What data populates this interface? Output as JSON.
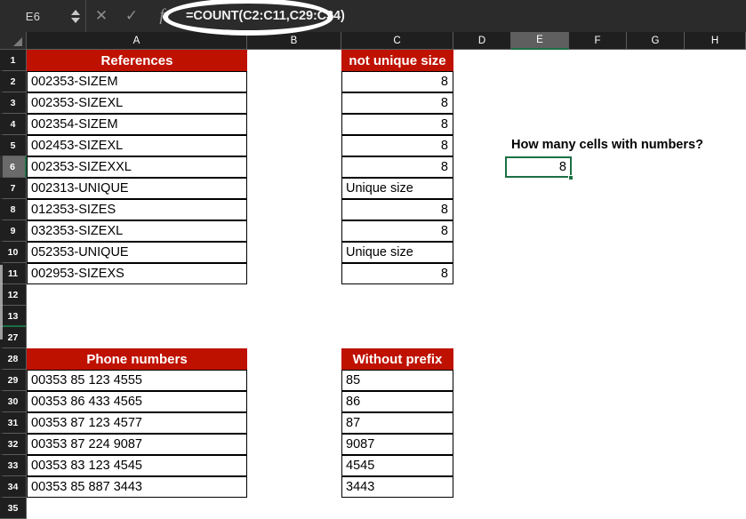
{
  "formula_bar": {
    "name_box": "E6",
    "cancel_icon": "close-icon",
    "confirm_icon": "check-icon",
    "function_icon": "fx-icon",
    "formula": "=COUNT(C2:C11,C29:C34)"
  },
  "columns": [
    {
      "label": "A",
      "active": false
    },
    {
      "label": "B",
      "active": false
    },
    {
      "label": "C",
      "active": false
    },
    {
      "label": "D",
      "active": false
    },
    {
      "label": "E",
      "active": true
    },
    {
      "label": "F",
      "active": false
    },
    {
      "label": "G",
      "active": false
    },
    {
      "label": "H",
      "active": false
    }
  ],
  "rows": [
    {
      "label": "1",
      "active": false,
      "break": false
    },
    {
      "label": "2",
      "active": false,
      "break": false
    },
    {
      "label": "3",
      "active": false,
      "break": false
    },
    {
      "label": "4",
      "active": false,
      "break": false
    },
    {
      "label": "5",
      "active": false,
      "break": false
    },
    {
      "label": "6",
      "active": true,
      "break": false
    },
    {
      "label": "7",
      "active": false,
      "break": false
    },
    {
      "label": "8",
      "active": false,
      "break": false
    },
    {
      "label": "9",
      "active": false,
      "break": false
    },
    {
      "label": "10",
      "active": false,
      "break": false
    },
    {
      "label": "11",
      "active": false,
      "break": false
    },
    {
      "label": "12",
      "active": false,
      "break": false
    },
    {
      "label": "13",
      "active": false,
      "break": true
    },
    {
      "label": "27",
      "active": false,
      "break": false
    },
    {
      "label": "28",
      "active": false,
      "break": false
    },
    {
      "label": "29",
      "active": false,
      "break": false
    },
    {
      "label": "30",
      "active": false,
      "break": false
    },
    {
      "label": "31",
      "active": false,
      "break": false
    },
    {
      "label": "32",
      "active": false,
      "break": false
    },
    {
      "label": "33",
      "active": false,
      "break": false
    },
    {
      "label": "34",
      "active": false,
      "break": false
    },
    {
      "label": "35",
      "active": false,
      "break": false
    }
  ],
  "table_references": {
    "header": "References",
    "values": [
      "002353-SIZEM",
      "002353-SIZEXL",
      "002354-SIZEM",
      "002453-SIZEXL",
      "002353-SIZEXXL",
      "002313-UNIQUE",
      "012353-SIZES",
      "032353-SIZEXL",
      "052353-UNIQUE",
      "002953-SIZEXS"
    ]
  },
  "table_not_unique_size": {
    "header": "not unique size",
    "values": [
      "8",
      "8",
      "8",
      "8",
      "8",
      "Unique size",
      "8",
      "8",
      "Unique size",
      "8"
    ],
    "alignments": [
      "right",
      "right",
      "right",
      "right",
      "right",
      "left",
      "right",
      "right",
      "left",
      "right"
    ]
  },
  "table_phone_numbers": {
    "header": "Phone numbers",
    "values": [
      "00353 85 123 4555",
      "00353 86 433 4565",
      "00353 87 123 4577",
      "00353 87 224 9087",
      "00353 83 123 4545",
      "00353 85 887 3443"
    ]
  },
  "table_without_prefix": {
    "header": "Without prefix",
    "values": [
      "85",
      "86",
      "87",
      "9087",
      "4545",
      "3443"
    ]
  },
  "question": {
    "label": "How many cells with numbers?",
    "result_value": "8"
  },
  "colors": {
    "header_red": "#bf1100",
    "selection_green": "#1d7044",
    "chrome_dark": "#2b2b2b",
    "annotation_white": "#ffffff"
  }
}
